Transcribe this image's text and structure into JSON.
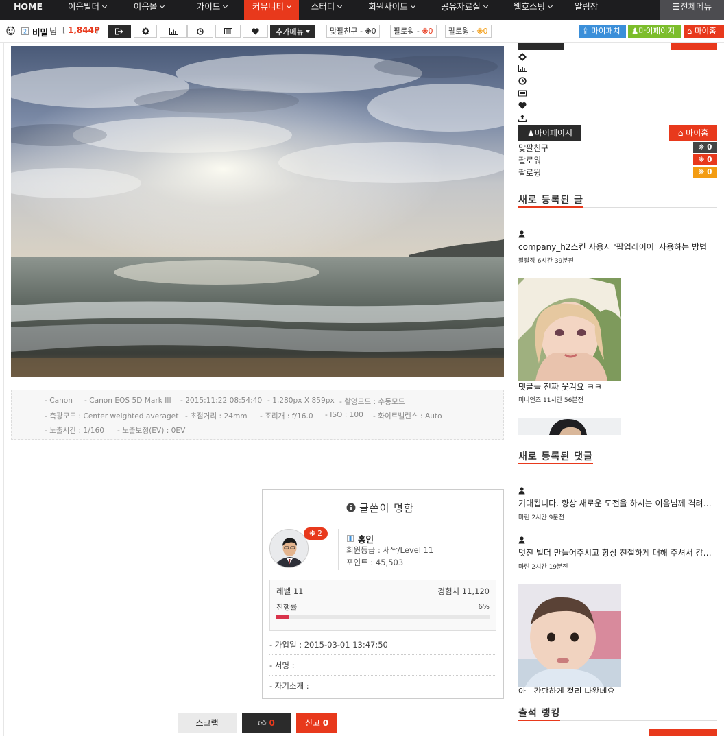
{
  "nav": {
    "items": [
      {
        "label": "HOME",
        "chevron": false,
        "active": false
      },
      {
        "label": "이음빌더",
        "chevron": true,
        "active": false
      },
      {
        "label": "이음몰",
        "chevron": true,
        "active": false
      },
      {
        "label": "가이드",
        "chevron": true,
        "active": false
      },
      {
        "label": "커뮤니티",
        "chevron": true,
        "active": true
      },
      {
        "label": "스터디",
        "chevron": true,
        "active": false
      },
      {
        "label": "회원사이트",
        "chevron": true,
        "active": false
      },
      {
        "label": "공유자료실",
        "chevron": true,
        "active": false
      },
      {
        "label": "웹호스팅",
        "chevron": true,
        "active": false
      },
      {
        "label": "알림장",
        "chevron": false,
        "active": false
      }
    ],
    "all_menu": "전체메뉴"
  },
  "userbar": {
    "name": "비밀",
    "name_suffix": "님",
    "points_open": "[",
    "points": "1,844P",
    "points_close": "]",
    "more_menu": "추가메뉴",
    "friend": {
      "label": "맞팔친구 - ",
      "count": "0"
    },
    "follower": {
      "label": "팔로워 - ",
      "count": "0"
    },
    "following": {
      "label": "팔로윙 - ",
      "count": "0"
    },
    "btn_mypatch": "마이패치",
    "btn_mypage": "마이페이지",
    "btn_myhome": "마이홈"
  },
  "exif": {
    "items": [
      "- Canon",
      "- Canon EOS 5D Mark III",
      "- 2015:11:22 08:54:40",
      "- 1,280px X 859px",
      "- 촬영모드 : 수동모드",
      "- 측광모드 : Center weighted averaget",
      "- 초점거리 : 24mm",
      "- 조리개 : f/16.0",
      "- ISO : 100",
      "- 화이트밸런스 : Auto",
      "- 노출시간 : 1/160",
      "- 노출보정(EV) : 0EV"
    ]
  },
  "card": {
    "title": "글쓴이 명함",
    "badge": "2",
    "author": "홍인",
    "grade": "회원등급 : 새싹/Level 11",
    "points": "포인트 : 45,503",
    "level": "레벨 11",
    "exp": "경험치 11,120",
    "progress_label": "진행률",
    "progress_text": "6%",
    "progress": 0.06,
    "joined": "- 가입일 : 2015-03-01 13:47:50",
    "signature": "- 서명 :",
    "intro": "- 자기소개 :"
  },
  "actions": {
    "scrap": "스크랩",
    "like": "0",
    "report": "신고",
    "report_count": "0"
  },
  "sidebar": {
    "mypage": "마이페이지",
    "myhome": "마이홈",
    "friend": {
      "label": "맞팔친구",
      "count": "0"
    },
    "follower": {
      "label": "팔로워",
      "count": "0"
    },
    "following": {
      "label": "팔로윙",
      "count": "0"
    },
    "new_posts_title": "새로 등록된 글",
    "posts": [
      {
        "title": "company_h2스킨 사용시 '팝업레이어' 사용하는 방법",
        "meta": "팔팔장 6시간 39분전"
      },
      {
        "title": "댓글들 진짜 웃겨요 ㅋㅋ",
        "meta": "미니언즈 11시간 56분전"
      }
    ],
    "new_comments_title": "새로 등록된 댓글",
    "comments": [
      {
        "title": "기대됩니다. 향상 새로운 도전을 하시는 이음님께 격려를 보냅니다",
        "meta": "마린 2시간 9분전"
      },
      {
        "title": "멋진 빌더 만들어주시고 항상 친절하게 대해 주셔서 감사합니다",
        "meta": "마린 2시간 19분전"
      },
      {
        "title": "아.. 간단하게 정리 나왔네요",
        "meta": ""
      }
    ],
    "attendance_title": "출석 랭킹"
  },
  "colors": {
    "accent": "#e8391c",
    "nav_bg": "#1d1d1f",
    "blue": "#3b8fd9",
    "green": "#7cbd2b",
    "orange": "#f39c12"
  }
}
